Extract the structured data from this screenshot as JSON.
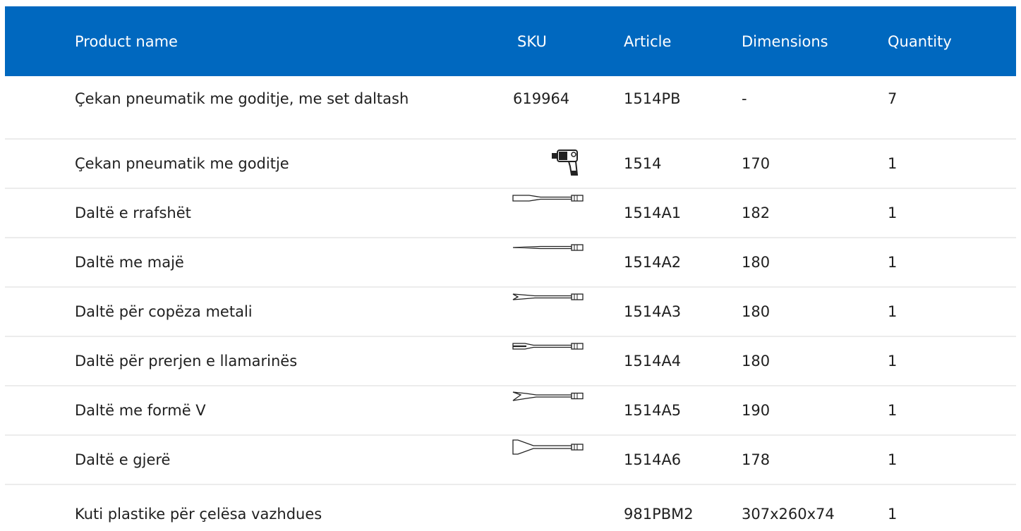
{
  "header": {
    "product_name": "Product name",
    "sku": "SKU",
    "article": "Article",
    "dimensions": "Dimensions",
    "quantity": "Quantity"
  },
  "rows": [
    {
      "name": "Çekan pneumatik me goditje, me set daltash",
      "sku": "619964",
      "article": "1514PB",
      "dimensions": "-",
      "quantity": "7"
    },
    {
      "name": "Çekan pneumatik me goditje",
      "sku_icon": "air-hammer-icon",
      "article": "1514",
      "dimensions": "170",
      "quantity": "1"
    },
    {
      "name": "Daltë e rrafshët",
      "sku_icon": "flat-chisel-icon",
      "article": "1514A1",
      "dimensions": "182",
      "quantity": "1"
    },
    {
      "name": "Daltë me majë",
      "sku_icon": "pointed-chisel-icon",
      "article": "1514A2",
      "dimensions": "180",
      "quantity": "1"
    },
    {
      "name": "Daltë për copëza metali",
      "sku_icon": "metal-chisel-icon",
      "article": "1514A3",
      "dimensions": "180",
      "quantity": "1"
    },
    {
      "name": "Daltë për prerjen e llamarinës",
      "sku_icon": "sheet-cutter-chisel-icon",
      "article": "1514A4",
      "dimensions": "180",
      "quantity": "1"
    },
    {
      "name": "Daltë me formë V",
      "sku_icon": "v-chisel-icon",
      "article": "1514A5",
      "dimensions": "190",
      "quantity": "1"
    },
    {
      "name": "Daltë e gjerë",
      "sku_icon": "wide-chisel-icon",
      "article": "1514A6",
      "dimensions": "178",
      "quantity": "1"
    },
    {
      "name": "Kuti plastike për çelësa vazhdues",
      "sku": "",
      "article": "981PBM2",
      "dimensions": "307x260x74",
      "quantity": "1"
    }
  ],
  "colors": {
    "header_bg": "#0068bf",
    "header_text": "#ffffff",
    "row_divider": "#ececec",
    "body_text": "#1f1f1f"
  }
}
